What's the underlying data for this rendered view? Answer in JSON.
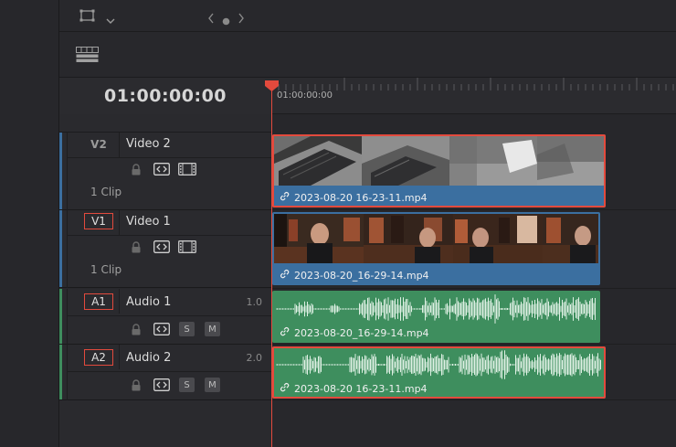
{
  "timeline": {
    "timecode": "01:00:00:00",
    "ruler_start": "01:00:00:00"
  },
  "colors": {
    "video_track": "#3b6fa0",
    "audio_track": "#3e8e5e",
    "selection": "#e34a3d",
    "playhead": "#e34a3d"
  },
  "tracks": [
    {
      "id": "V2",
      "name": "Video 2",
      "clip_count": "1 Clip",
      "kind": "video",
      "boxed": false
    },
    {
      "id": "V1",
      "name": "Video 1",
      "clip_count": "1 Clip",
      "kind": "video",
      "boxed": true
    },
    {
      "id": "A1",
      "name": "Audio 1",
      "level": "1.0",
      "kind": "audio",
      "boxed": true
    },
    {
      "id": "A2",
      "name": "Audio 2",
      "level": "2.0",
      "kind": "audio",
      "boxed": true
    }
  ],
  "audio_buttons": {
    "solo": "S",
    "mute": "M"
  },
  "clips": {
    "v2": {
      "name": "2023-08-20 16-23-11.mp4",
      "selected": true
    },
    "v1": {
      "name": "2023-08-20_16-29-14.mp4",
      "selected": false
    },
    "a1": {
      "name": "2023-08-20_16-29-14.mp4",
      "selected": false
    },
    "a2": {
      "name": "2023-08-20 16-23-11.mp4",
      "selected": true
    }
  },
  "icons": [
    "selection-mode-icon",
    "chevron-down-icon",
    "nav-back-icon",
    "nav-dot-icon",
    "nav-forward-icon",
    "timeline-view-options-icon",
    "lock-icon",
    "auto-select-icon",
    "video-toggle-icon",
    "link-icon",
    "playhead-icon"
  ]
}
